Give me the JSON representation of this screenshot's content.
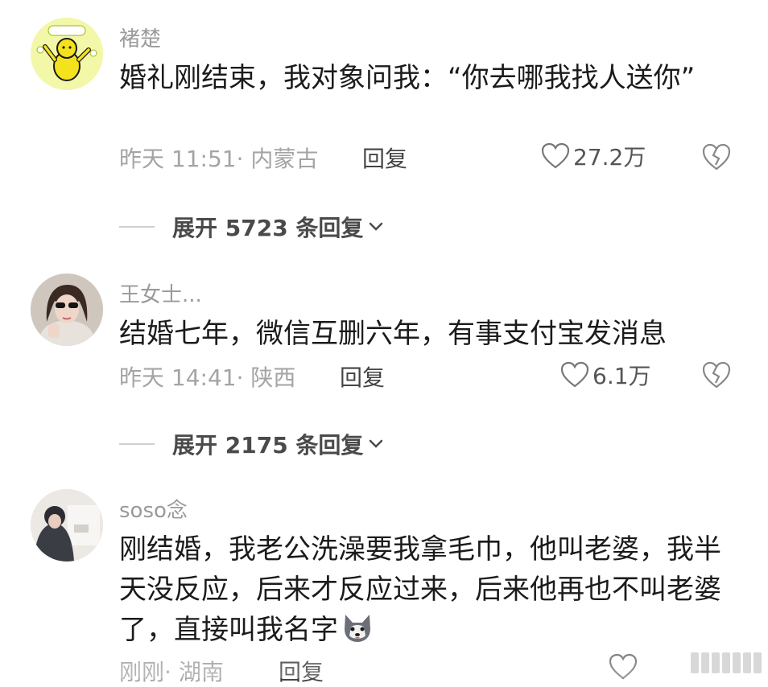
{
  "comments": [
    {
      "username": "褚楚",
      "text": "婚礼刚结束，我对象问我：“你去哪我找人送你”",
      "time": "昨天 11:51",
      "location": "· 内蒙古",
      "reply_label": "回复",
      "likes": "27.2万",
      "expand_label": "展开 5723 条回复"
    },
    {
      "username": "王女士...",
      "text": "结婚七年，微信互删六年，有事支付宝发消息",
      "time": "昨天 14:41",
      "location": "· 陕西",
      "reply_label": "回复",
      "likes": "6.1万",
      "expand_label": "展开 2175 条回复"
    },
    {
      "username": "soso念",
      "text": "刚结婚，我老公洗澡要我拿毛巾，他叫老婆，我半天没反应，后来才反应过来，后来他再也不叫老婆了，直接叫我名字",
      "time": "刚刚",
      "location": "· 湖南",
      "reply_label": "回复"
    }
  ],
  "icons": {
    "like": "heart-outline-icon",
    "dislike": "broken-heart-icon",
    "expand": "chevron-down-icon",
    "emoji": "husky-dog-emoji"
  },
  "colors": {
    "text": "#1b1b1b",
    "muted": "#a4a4a4",
    "username": "#9a9a9a",
    "avatar_1_bg": "#f3f7a8",
    "avatar_1_figure": "#f4e21c"
  }
}
